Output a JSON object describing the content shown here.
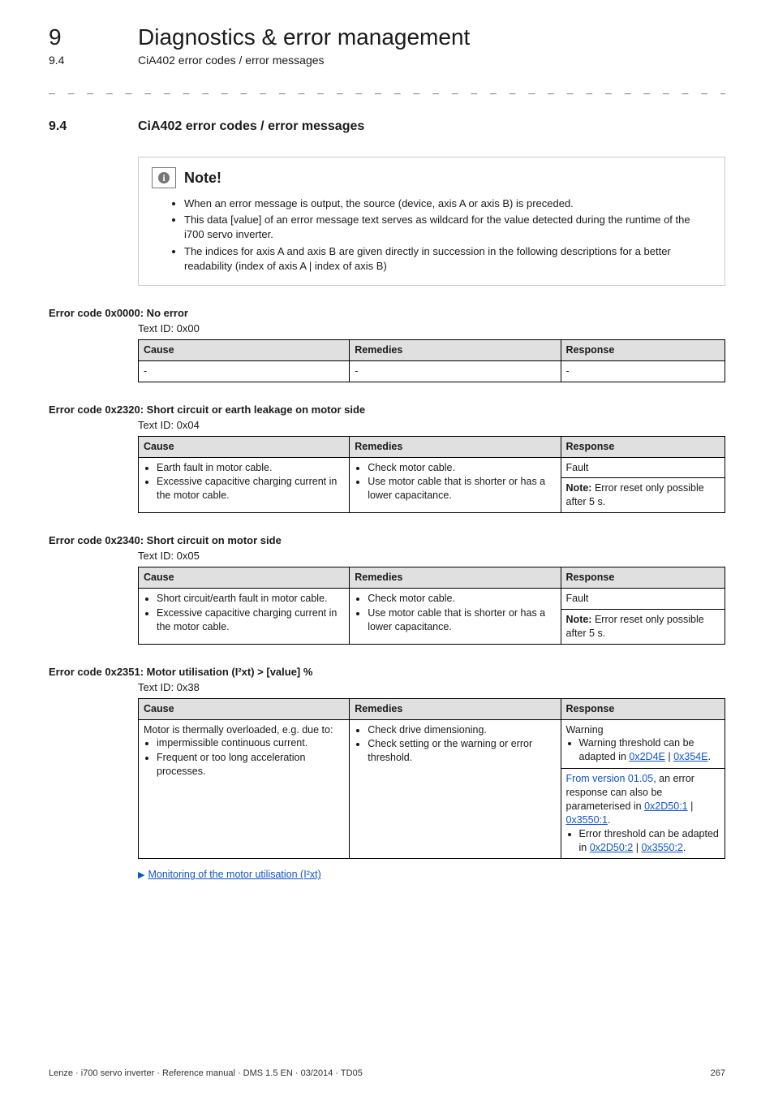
{
  "header": {
    "chapter_num": "9",
    "chapter_title": "Diagnostics & error management",
    "section_num": "9.4",
    "section_title": "CiA402 error codes / error messages"
  },
  "dashline": "_ _ _ _ _ _ _ _ _ _ _ _ _ _ _ _ _ _ _ _ _ _ _ _ _ _ _ _ _ _ _ _ _ _ _ _ _ _ _ _ _ _ _ _ _ _ _ _ _ _ _ _ _ _ _ _ _ _ _ _ _ _ _ _",
  "section_heading": {
    "num": "9.4",
    "title": "CiA402 error codes / error messages"
  },
  "note": {
    "label": "Note!",
    "bullets": [
      "When an error message is output, the source (device, axis A or axis B) is preceded.",
      "This data [value] of an error message text serves as wildcard for the value detected during the runtime of the i700 servo inverter.",
      "The indices for axis A and axis B are given directly in succession in the following descriptions for a better readability (index of axis A | index of axis B)"
    ]
  },
  "tables": {
    "headers": {
      "cause": "Cause",
      "remedies": "Remedies",
      "response": "Response"
    }
  },
  "errors": [
    {
      "id": "err-0x0000",
      "heading": "Error code 0x0000: No error",
      "textid": "Text ID: 0x00",
      "rows": [
        {
          "cause": "-",
          "remedies": "-",
          "response": "-"
        }
      ]
    },
    {
      "id": "err-0x2320",
      "heading": "Error code 0x2320: Short circuit or earth leakage on motor side",
      "textid": "Text ID: 0x04",
      "cause_list": [
        "Earth fault in motor cable.",
        "Excessive capacitive charging current in the motor cable."
      ],
      "rem_list": [
        "Check motor cable.",
        "Use motor cable that is shorter or has a lower capacitance."
      ],
      "resp_top": "Fault",
      "resp_bottom_prefix": "Note:",
      "resp_bottom_rest": " Error reset only possible after 5 s."
    },
    {
      "id": "err-0x2340",
      "heading": "Error code 0x2340: Short circuit on motor side",
      "textid": "Text ID: 0x05",
      "cause_list": [
        "Short circuit/earth fault in motor cable.",
        "Excessive capacitive charging current in the motor cable."
      ],
      "rem_list": [
        "Check motor cable.",
        "Use motor cable that is shorter or has a lower capacitance."
      ],
      "resp_top": "Fault",
      "resp_bottom_prefix": "Note:",
      "resp_bottom_rest": " Error reset only possible after 5 s."
    },
    {
      "id": "err-0x2351",
      "heading": "Error code 0x2351: Motor utilisation (I²xt) > [value] %",
      "textid": "Text ID: 0x38",
      "cause_text_top": "Motor is thermally overloaded, e.g. due to:",
      "cause_sub": [
        "impermissible continuous current.",
        "Frequent or too long acceleration processes."
      ],
      "rem_list": [
        "Check drive dimensioning.",
        "Check setting or the warning or error threshold."
      ],
      "resp_top_label": "Warning",
      "resp_top_bullet_prefix": "Warning threshold can be adapted in ",
      "resp_top_links": [
        "0x2D4E",
        "0x354E"
      ],
      "resp_bottom_intro_prefix": "From version 01.05",
      "resp_bottom_intro_rest": ", an error response can also be parameterised in ",
      "resp_bottom_intro_links": [
        "0x2D50:1",
        "0x3550:1"
      ],
      "resp_bottom_bullet_prefix": "Error threshold can be adapted in ",
      "resp_bottom_bullet_links": [
        "0x2D50:2",
        "0x3550:2"
      ],
      "followup_link": "Monitoring of the motor utilisation (I²xt)"
    }
  ],
  "footer": {
    "left": "Lenze · i700 servo inverter · Reference manual · DMS 1.5 EN · 03/2014 · TD05",
    "right": "267"
  }
}
